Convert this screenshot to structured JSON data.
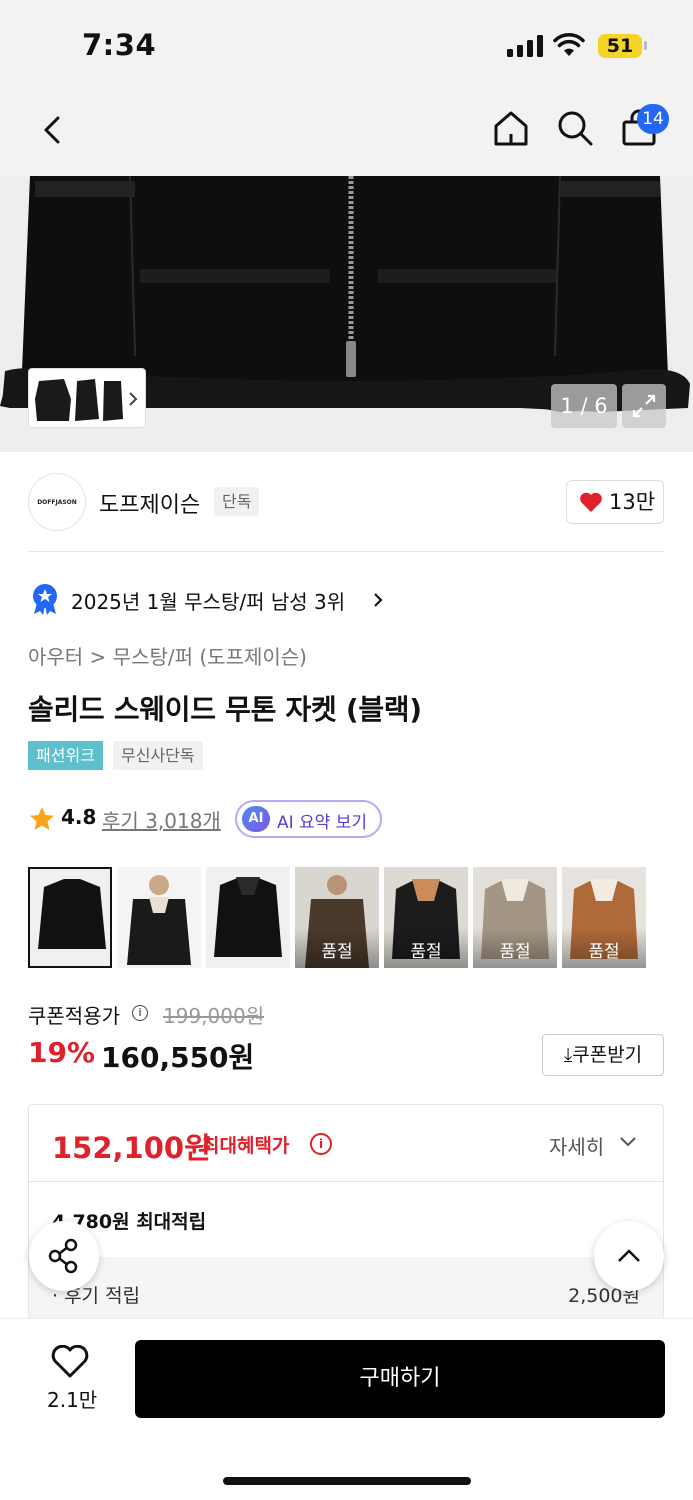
{
  "status": {
    "time": "7:34",
    "battery": "51"
  },
  "nav": {
    "cart_count": "14",
    "icons": [
      "back-icon",
      "home-icon",
      "search-icon",
      "bag-icon"
    ]
  },
  "hero": {
    "counter": "1 / 6"
  },
  "brand": {
    "logo_text": "DOFFJASON",
    "name": "도프제이슨",
    "badge": "단독",
    "likes": "13만"
  },
  "ranking": {
    "text": "2025년 1월 무스탕/퍼 남성 3위"
  },
  "product": {
    "breadcrumb": "아우터 > 무스탕/퍼 (도프제이슨)",
    "title": "솔리드 스웨이드 무톤 자켓 (블랙)",
    "tags": [
      "패션위크",
      "무신사단독"
    ],
    "rating": "4.8",
    "reviews": "후기 3,018개",
    "ai_summary": "AI 요약 보기",
    "ai_logo": "AI"
  },
  "colors": [
    {
      "label": "",
      "soldout": false
    },
    {
      "label": "",
      "soldout": false
    },
    {
      "label": "",
      "soldout": false
    },
    {
      "label": "품절",
      "soldout": true
    },
    {
      "label": "품절",
      "soldout": true
    },
    {
      "label": "품절",
      "soldout": true
    },
    {
      "label": "품절",
      "soldout": true
    }
  ],
  "price": {
    "coupon_label": "쿠폰적용가",
    "original": "199,000원",
    "discount": "19%",
    "sale": "160,550원",
    "coupon_button": "쿠폰받기"
  },
  "benefit": {
    "best_price": "152,100원",
    "best_label": "최대혜택가",
    "detail": "자세히",
    "points": "4,780원 최대적립",
    "review_points_label": "· 후기 적립",
    "review_points_value": "2,500원"
  },
  "bottom": {
    "fav_count": "2.1만",
    "buy": "구매하기"
  },
  "accent_colors": {
    "red": "#e0202a",
    "blue": "#2467f5",
    "teal": "#5ebfcd"
  }
}
